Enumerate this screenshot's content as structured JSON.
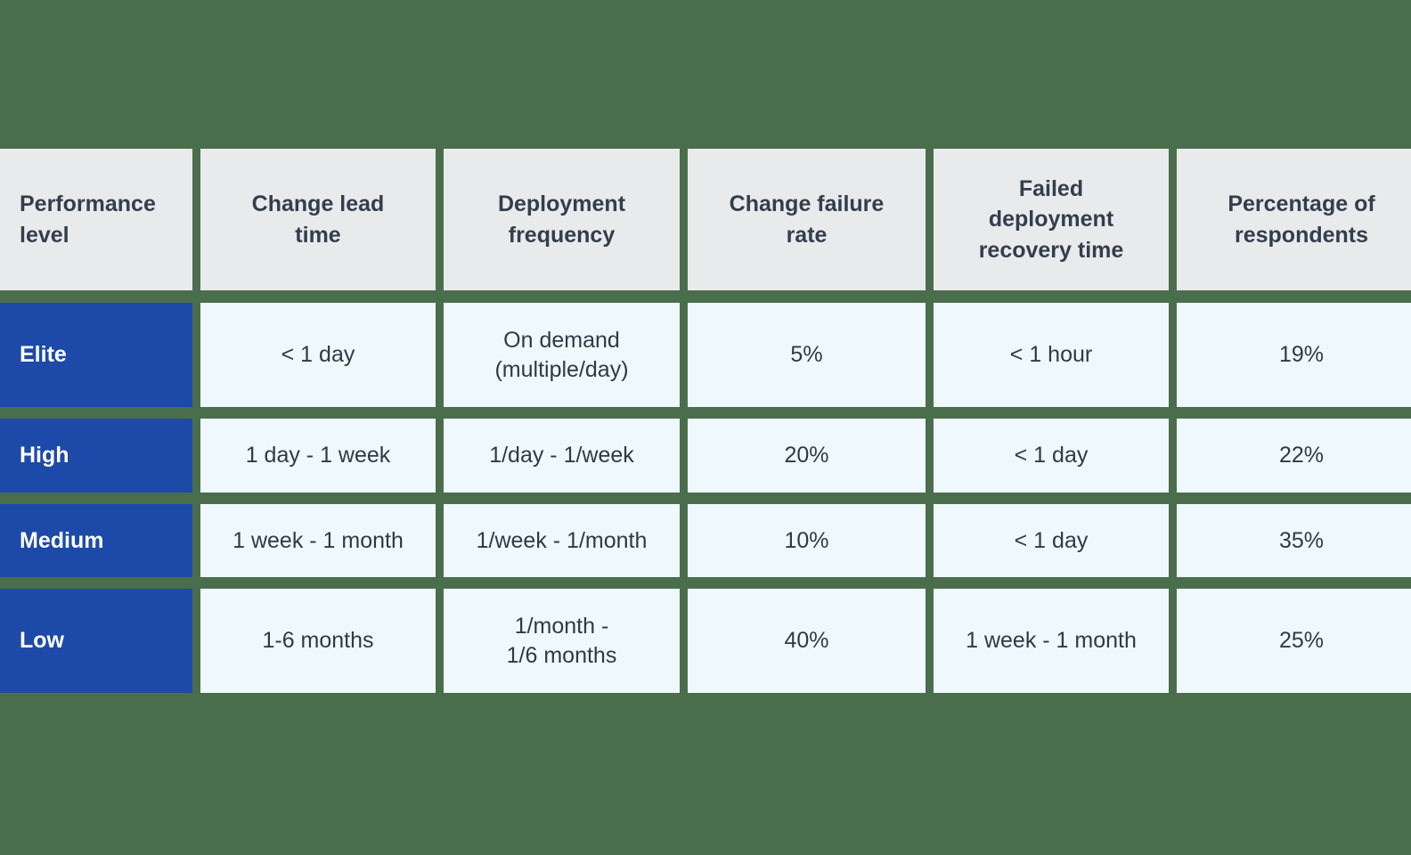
{
  "theme": {
    "background_green": "#4a6e4c",
    "header_gray": "#e9eaec",
    "cell_blue_tint": "#eff8fd",
    "label_blue": "#1d4aa8",
    "text_dark": "#2e3a47",
    "text_light": "#ffffff"
  },
  "table": {
    "columns": [
      {
        "id": "performance-level",
        "label_lines": [
          "Performance",
          "level"
        ]
      },
      {
        "id": "change-lead-time",
        "label_lines": [
          "Change lead",
          "time"
        ]
      },
      {
        "id": "deployment-frequency",
        "label_lines": [
          "Deployment",
          "frequency"
        ]
      },
      {
        "id": "change-failure-rate",
        "label_lines": [
          "Change failure",
          "rate"
        ]
      },
      {
        "id": "failed-deployment-recovery-time",
        "label_lines": [
          "Failed",
          "deployment",
          "recovery time"
        ]
      },
      {
        "id": "percentage-of-respondents",
        "label_lines": [
          "Percentage of",
          "respondents"
        ]
      }
    ],
    "rows": [
      {
        "level": "Elite",
        "change_lead_time": [
          "< 1 day"
        ],
        "deployment_frequency": [
          "On demand",
          "(multiple/day)"
        ],
        "change_failure_rate": [
          "5%"
        ],
        "failed_deployment_recovery_time": [
          "< 1 hour"
        ],
        "percentage_of_respondents": [
          "19%"
        ]
      },
      {
        "level": "High",
        "change_lead_time": [
          "1 day - 1 week"
        ],
        "deployment_frequency": [
          "1/day - 1/week"
        ],
        "change_failure_rate": [
          "20%"
        ],
        "failed_deployment_recovery_time": [
          "< 1 day"
        ],
        "percentage_of_respondents": [
          "22%"
        ]
      },
      {
        "level": "Medium",
        "change_lead_time": [
          "1 week - 1 month"
        ],
        "deployment_frequency": [
          "1/week - 1/month"
        ],
        "change_failure_rate": [
          "10%"
        ],
        "failed_deployment_recovery_time": [
          "< 1 day"
        ],
        "percentage_of_respondents": [
          "35%"
        ]
      },
      {
        "level": "Low",
        "change_lead_time": [
          "1-6 months"
        ],
        "deployment_frequency": [
          "1/month -",
          "1/6 months"
        ],
        "change_failure_rate": [
          "40%"
        ],
        "failed_deployment_recovery_time": [
          "1 week - 1 month"
        ],
        "percentage_of_respondents": [
          "25%"
        ]
      }
    ]
  }
}
